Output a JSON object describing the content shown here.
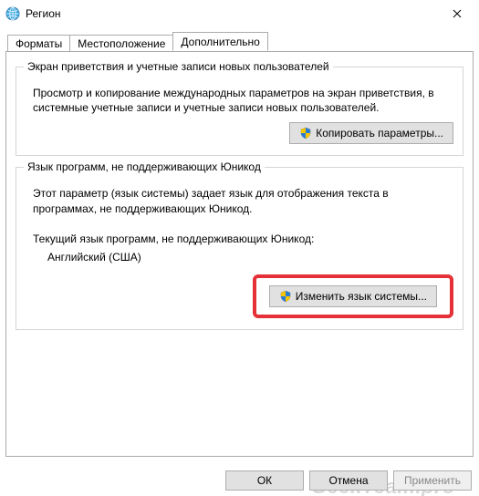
{
  "window": {
    "title": "Регион"
  },
  "tabs": {
    "items": [
      {
        "label": "Форматы"
      },
      {
        "label": "Местоположение"
      },
      {
        "label": "Дополнительно"
      }
    ],
    "active_index": 2
  },
  "group_welcome": {
    "legend": "Экран приветствия и учетные записи новых пользователей",
    "desc": "Просмотр и копирование международных параметров на экран приветствия, в системные учетные записи и учетные записи новых пользователей.",
    "button_label": "Копировать параметры..."
  },
  "group_nonunicode": {
    "legend": "Язык программ, не поддерживающих Юникод",
    "desc": "Этот параметр (язык системы) задает язык для отображения текста в программах, не поддерживающих Юникод.",
    "current_label": "Текущий язык программ, не поддерживающих Юникод:",
    "current_value": "Английский (США)",
    "button_label": "Изменить язык системы..."
  },
  "footer": {
    "ok": "ОК",
    "cancel": "Отмена",
    "apply": "Применить"
  },
  "watermark": "GeekTeam.pro",
  "icons": {
    "globe": "globe-icon",
    "close": "close-icon",
    "shield": "uac-shield-icon"
  }
}
